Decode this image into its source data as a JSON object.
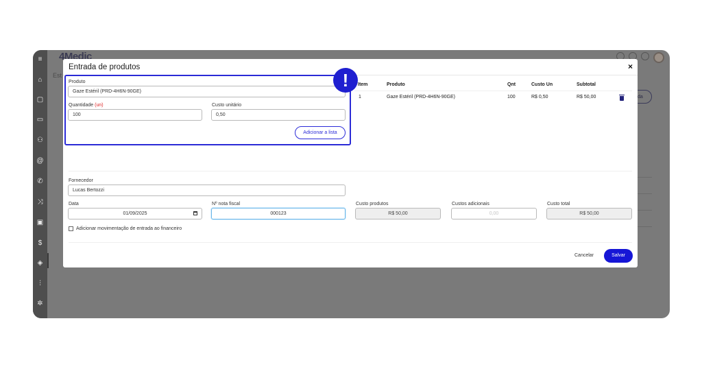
{
  "app": {
    "logo": "4Medic",
    "breadcrumb_fragment": "Est",
    "bg_button_fragment": "da"
  },
  "modal": {
    "title": "Entrada de produtos",
    "close_glyph": "×"
  },
  "form": {
    "produto_label": "Produto",
    "produto_value": "Gaze Estéril (PRD-4H6N-90GE)",
    "quantidade_label": "Quantidade",
    "quantidade_unit": "(un)",
    "quantidade_value": "100",
    "custo_unitario_label": "Custo unitário",
    "custo_unitario_value": "0,50",
    "add_button": "Adicionar a lista",
    "alert_glyph": "!"
  },
  "table": {
    "headers": [
      "Item",
      "Produto",
      "Qnt",
      "Custo Un",
      "Subtotal"
    ],
    "rows": [
      {
        "item": "1",
        "produto": "Gaze Estéril (PRD-4H6N-90GE)",
        "qnt": "100",
        "custo_un": "R$ 0,50",
        "subtotal": "R$ 50,00"
      }
    ]
  },
  "footer_form": {
    "fornecedor_label": "Fornecedor",
    "fornecedor_value": "Lucas Bertozzi",
    "data_label": "Data",
    "data_value": "01/09/2025",
    "nota_fiscal_label": "Nº nota fiscal",
    "nota_fiscal_value": "000123",
    "custo_produtos_label": "Custo produtos",
    "custo_produtos_value": "R$ 50,00",
    "custos_adicionais_label": "Custos adicionais",
    "custos_adicionais_placeholder": "0,00",
    "custo_total_label": "Custo total",
    "custo_total_value": "R$ 50,00",
    "financeiro_checkbox_label": "Adicionar movimentação de entrada ao financeiro"
  },
  "actions": {
    "cancel": "Cancelar",
    "save": "Salvar"
  },
  "colors": {
    "primary": "#1616d6",
    "highlight": "#2a2ad6",
    "required": "#dd2222",
    "overlay": "#7a7a7a"
  },
  "icons": [
    "menu-icon",
    "home-icon",
    "calendar-icon",
    "inbox-icon",
    "users-icon",
    "at-icon",
    "phone-icon",
    "shuffle-icon",
    "clipboard-icon",
    "dollar-icon",
    "box-icon",
    "chart-icon",
    "settings-icon",
    "trash-icon",
    "calendar-picker-icon"
  ]
}
